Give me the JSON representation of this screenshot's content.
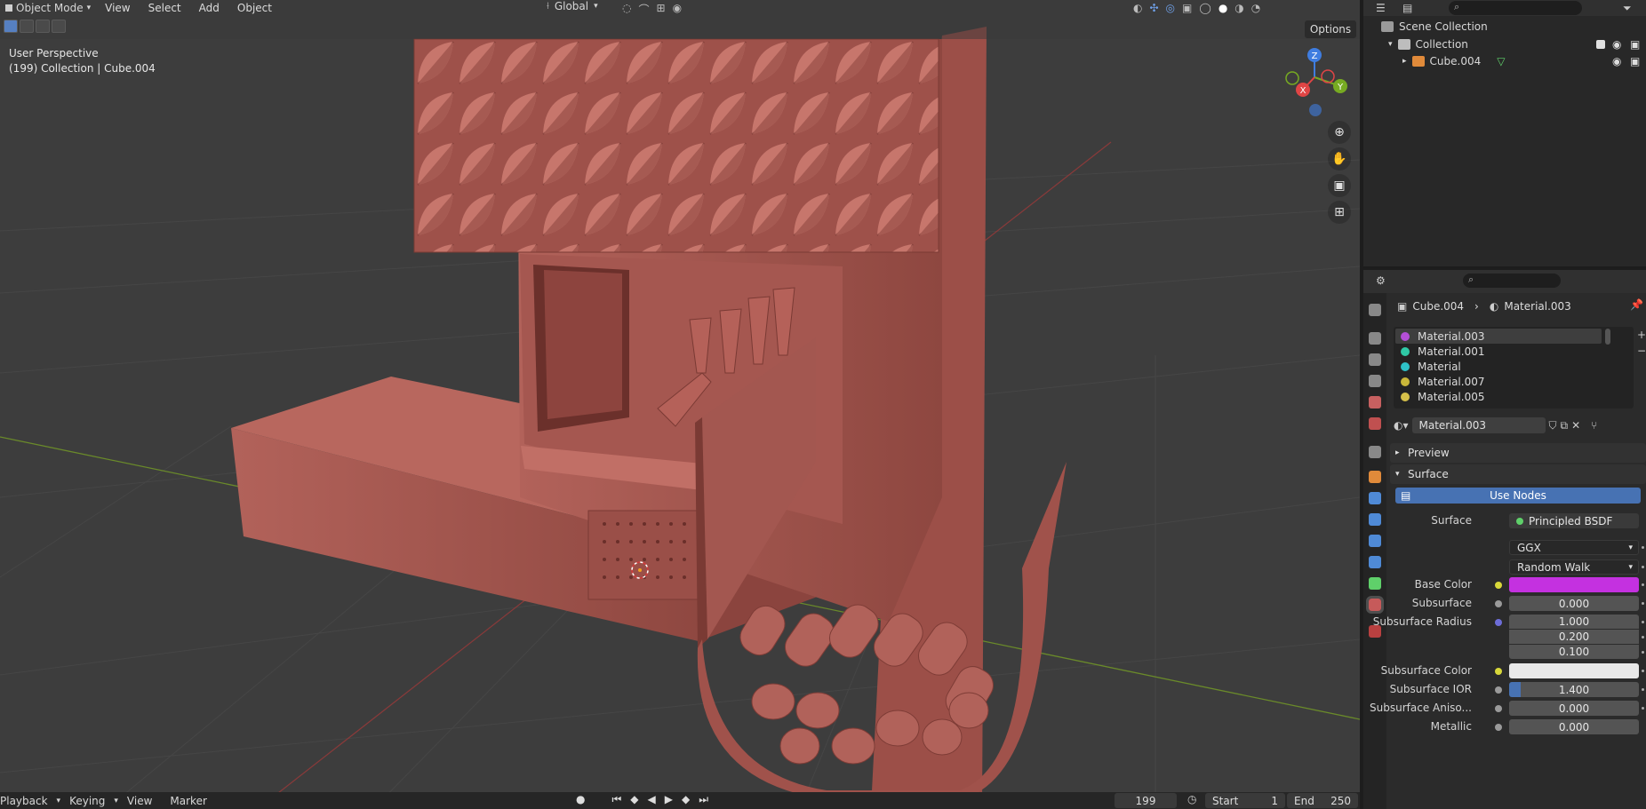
{
  "viewport": {
    "mode_label": "Object Mode",
    "menus": [
      "View",
      "Select",
      "Add",
      "Object"
    ],
    "transform_orientation": "Global",
    "perspective_label": "User Perspective",
    "context_label": "(199) Collection | Cube.004",
    "options_label": "Options",
    "gizmo_axes": {
      "z": "Z",
      "y": "Y",
      "x": "X"
    }
  },
  "timeline": {
    "menus": [
      "Playback",
      "Keying",
      "View",
      "Marker"
    ],
    "current_frame": "199",
    "start_label": "Start",
    "start_value": "1",
    "end_label": "End",
    "end_value": "250"
  },
  "outliner": {
    "scene_collection": "Scene Collection",
    "collection": "Collection",
    "object": "Cube.004"
  },
  "properties": {
    "breadcrumb_object": "Cube.004",
    "breadcrumb_material": "Material.003",
    "material_slots": [
      {
        "name": "Material.003",
        "color": "#b44fd6"
      },
      {
        "name": "Material.001",
        "color": "#2fc9a6"
      },
      {
        "name": "Material",
        "color": "#2fc2c9"
      },
      {
        "name": "Material.007",
        "color": "#c9b73a"
      },
      {
        "name": "Material.005",
        "color": "#d6c04a"
      }
    ],
    "active_material": "Material.003",
    "preview_label": "Preview",
    "surface_label": "Surface",
    "use_nodes_label": "Use Nodes",
    "surface_shader_label": "Surface",
    "surface_shader_value": "Principled BSDF",
    "distribution": "GGX",
    "subsurface_method": "Random Walk",
    "fields": {
      "base_color_label": "Base Color",
      "base_color": "#c431e0",
      "subsurface_label": "Subsurface",
      "subsurface_value": "0.000",
      "subsurface_radius_label": "Subsurface Radius",
      "subsurface_radius": [
        "1.000",
        "0.200",
        "0.100"
      ],
      "subsurface_color_label": "Subsurface Color",
      "subsurface_color": "#e8e8e8",
      "subsurface_ior_label": "Subsurface IOR",
      "subsurface_ior_value": "1.400",
      "subsurface_aniso_label": "Subsurface Aniso...",
      "subsurface_aniso_value": "0.000",
      "metallic_label": "Metallic",
      "metallic_value": "0.000"
    }
  }
}
